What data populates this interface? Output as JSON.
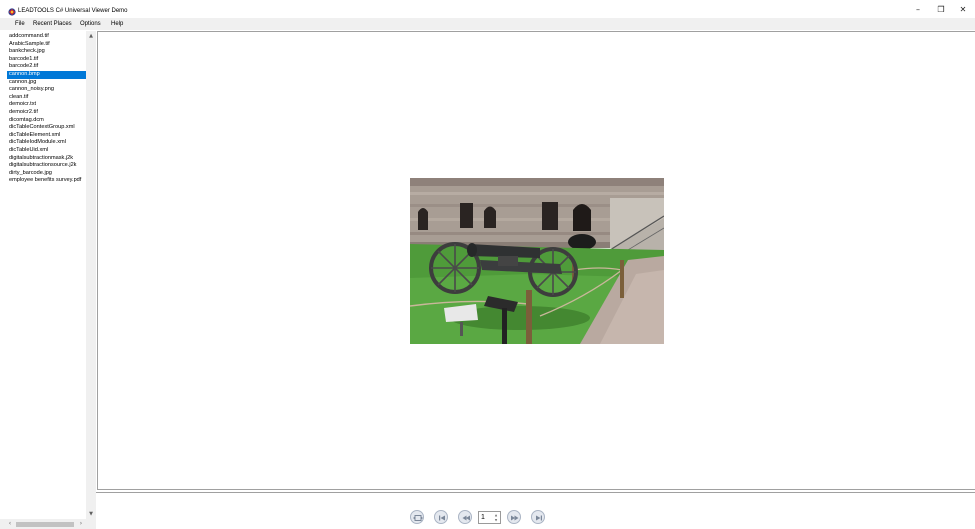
{
  "window": {
    "title": "LEADTOOLS C# Universal Viewer Demo",
    "minimize_glyph": "–",
    "restore_glyph": "❒",
    "close_glyph": "✕"
  },
  "menu": {
    "items": [
      "File",
      "Recent Places",
      "Options",
      "Help"
    ]
  },
  "file_list": {
    "items": [
      "addcommand.tif",
      "ArabicSample.tif",
      "bankcheck.jpg",
      "barcode1.tif",
      "barcode2.tif",
      "cannon.bmp",
      "cannon.jpg",
      "cannon_noisy.png",
      "clean.tif",
      "demoicr.txt",
      "demoicr2.tif",
      "dicomtag.dcm",
      "dicTableContextGroup.xml",
      "dicTableElement.xml",
      "dicTableIodModule.xml",
      "dicTableUid.xml",
      "digitalsubtractionmask.j2k",
      "digitalsubtractionsource.j2k",
      "dirty_barcode.jpg",
      "employee benefits survey.pdf"
    ],
    "selected_index": 5
  },
  "viewer": {
    "image_name": "cannon.bmp"
  },
  "pager": {
    "current_page": "1"
  },
  "icons": {
    "fit": "fit-page-icon",
    "first": "first-page-icon",
    "prev": "previous-page-icon",
    "next": "next-page-icon",
    "last": "last-page-icon"
  },
  "colors": {
    "selection": "#0078d7",
    "menubar": "#f0f0f0"
  }
}
